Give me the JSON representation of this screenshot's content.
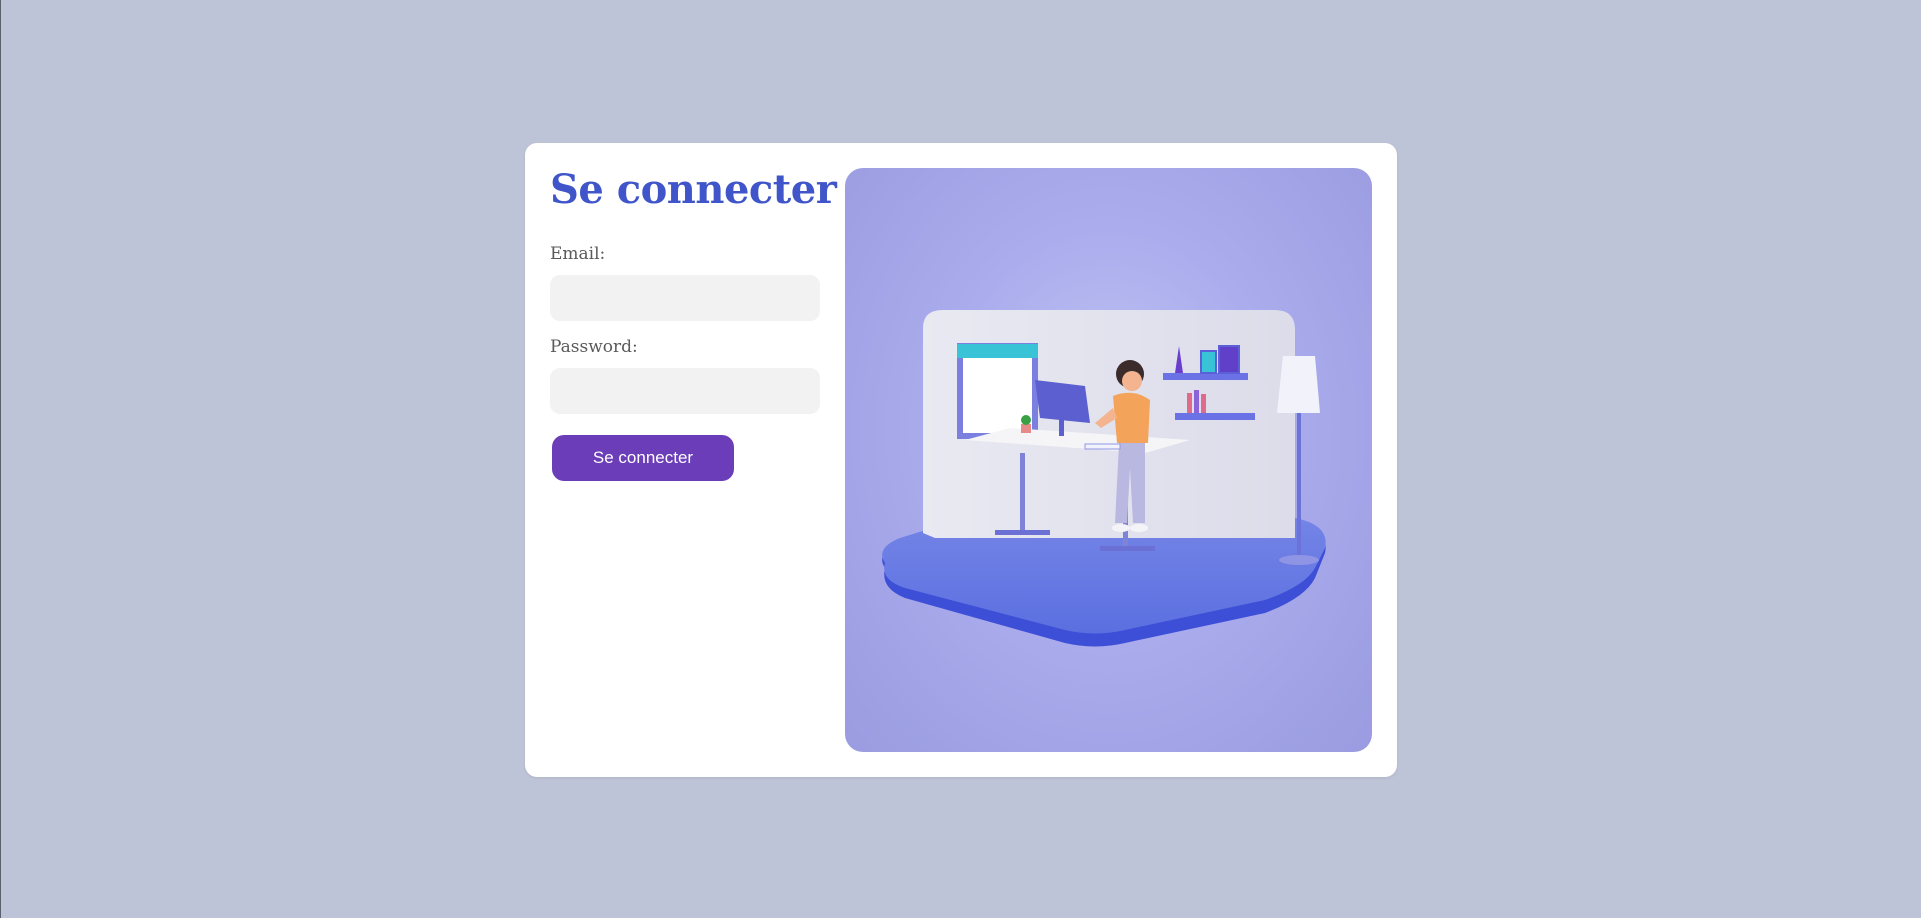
{
  "login": {
    "title": "Se connecter",
    "email_label": "Email:",
    "email_value": "",
    "password_label": "Password:",
    "password_value": "",
    "submit_label": "Se connecter"
  },
  "colors": {
    "background": "#bec4d7",
    "card": "#ffffff",
    "title": "#3f55c9",
    "button": "#6b3db8",
    "input": "#f2f2f2",
    "illustration_bg": "#aaaced"
  },
  "illustration": {
    "icon": "person-working-at-standing-desk-illustration"
  }
}
